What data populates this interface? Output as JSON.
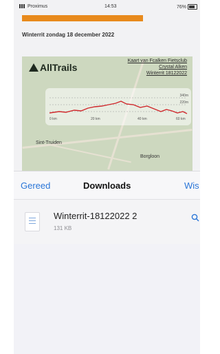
{
  "status_bar": {
    "carrier": "Proximus",
    "time": "14:53",
    "battery": "76%"
  },
  "document": {
    "title": "Winterrit zondag 18 december 2022",
    "map": {
      "logo": "AllTrails",
      "links": [
        "Kaart van Fcalken Fietsclub",
        "Crystal Alken",
        "Winterrit 18122022"
      ],
      "elevation_labels": [
        "340m",
        "220m"
      ],
      "distance_labels": [
        "0 km",
        "20 km",
        "40 km",
        "60 km"
      ],
      "places": [
        "Sint-Truiden",
        "Borgloon"
      ]
    }
  },
  "sheet": {
    "done": "Gereed",
    "title": "Downloads",
    "right_action": "Wis",
    "file": {
      "name": "Winterrit-18122022 2",
      "size": "131 KB",
      "action_icon": "magnifier-icon"
    }
  },
  "colors": {
    "accent": "#2a76d8",
    "progress": "#e88a1c",
    "route": "#d0282c"
  }
}
